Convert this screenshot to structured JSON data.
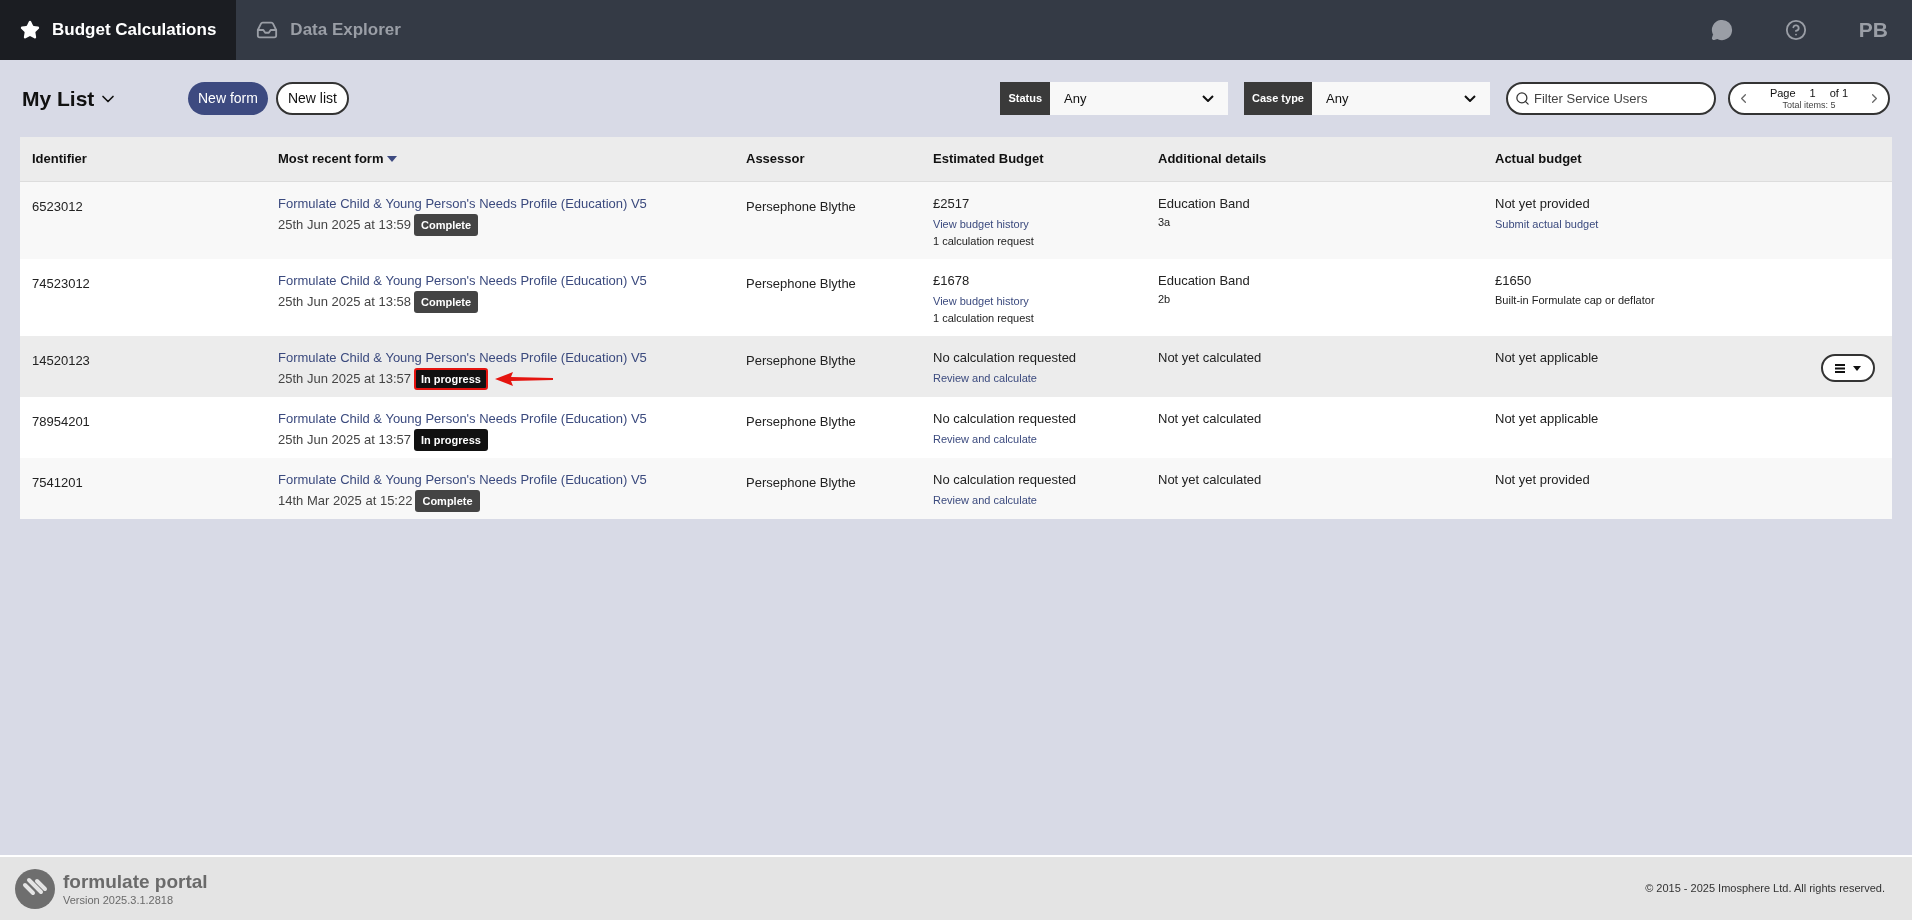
{
  "nav": {
    "tabs": [
      {
        "label": "Budget Calculations",
        "selected": true
      },
      {
        "label": "Data Explorer",
        "selected": false
      }
    ],
    "user_initials": "PB"
  },
  "toolbar": {
    "list_title": "My List",
    "buttons": [
      {
        "label": "New form",
        "kind": "primary"
      },
      {
        "label": "New list",
        "kind": "outline"
      }
    ],
    "filters": [
      {
        "label": "Status",
        "value": "Any"
      },
      {
        "label": "Case type",
        "value": "Any"
      }
    ],
    "search": {
      "placeholder": "Filter Service Users"
    },
    "pager": {
      "label": "Page",
      "page": "1",
      "of": "of 1",
      "total": "Total items: 5"
    }
  },
  "table": {
    "columns": [
      {
        "label": "Identifier",
        "sorted": false
      },
      {
        "label": "Most recent form",
        "sorted": true
      },
      {
        "label": "Assessor",
        "sorted": false
      },
      {
        "label": "Estimated Budget",
        "sorted": false
      },
      {
        "label": "Additional details",
        "sorted": false
      },
      {
        "label": "Actual budget",
        "sorted": false
      }
    ],
    "rows": [
      {
        "selected": false,
        "identifier": "6523012",
        "form": "Formulate Child & Young Person's Needs Profile (Education) V5",
        "date": "25th Jun 2025 at 13:59",
        "status": {
          "label": "Complete",
          "kind": "complete",
          "highlighted": false
        },
        "assessor": "Persephone Blythe",
        "estimated": {
          "main": "£2517",
          "link": "View budget history",
          "note": "1 calculation request"
        },
        "additional": {
          "main": "Education Band",
          "sub": "3a"
        },
        "actual": {
          "main": "Not yet provided",
          "link": "Submit actual budget"
        }
      },
      {
        "selected": false,
        "identifier": "74523012",
        "form": "Formulate Child & Young Person's Needs Profile (Education) V5",
        "date": "25th Jun 2025 at 13:58",
        "status": {
          "label": "Complete",
          "kind": "complete",
          "highlighted": false
        },
        "assessor": "Persephone Blythe",
        "estimated": {
          "main": "£1678",
          "link": "View budget history",
          "note": "1 calculation request"
        },
        "additional": {
          "main": "Education Band",
          "sub": "2b"
        },
        "actual": {
          "main": "£1650",
          "note": "Built-in Formulate cap or deflator"
        }
      },
      {
        "selected": true,
        "identifier": "14520123",
        "form": "Formulate Child & Young Person's Needs Profile (Education) V5",
        "date": "25th Jun 2025 at 13:57",
        "status": {
          "label": "In progress",
          "kind": "in_progress",
          "highlighted": true
        },
        "assessor": "Persephone Blythe",
        "estimated": {
          "main": "No calculation requested",
          "link": "Review and calculate"
        },
        "additional": {
          "main": "Not yet calculated"
        },
        "actual": {
          "main": "Not yet applicable"
        }
      },
      {
        "selected": false,
        "identifier": "78954201",
        "form": "Formulate Child & Young Person's Needs Profile (Education) V5",
        "date": "25th Jun 2025 at 13:57",
        "status": {
          "label": "In progress",
          "kind": "in_progress",
          "highlighted": false
        },
        "assessor": "Persephone Blythe",
        "estimated": {
          "main": "No calculation requested",
          "link": "Review and calculate"
        },
        "additional": {
          "main": "Not yet calculated"
        },
        "actual": {
          "main": "Not yet applicable"
        }
      },
      {
        "selected": false,
        "identifier": "7541201",
        "form": "Formulate Child & Young Person's Needs Profile (Education) V5",
        "date": "14th Mar 2025 at 15:22",
        "status": {
          "label": "Complete",
          "kind": "complete",
          "highlighted": false
        },
        "assessor": "Persephone Blythe",
        "estimated": {
          "main": "No calculation requested",
          "link": "Review and calculate"
        },
        "additional": {
          "main": "Not yet calculated"
        },
        "actual": {
          "main": "Not yet provided"
        }
      }
    ]
  },
  "footer": {
    "brand": "formulate portal",
    "version": "Version 2025.3.1.2818",
    "copyright": "© 2015 - 2025 Imosphere Ltd. All rights reserved."
  }
}
